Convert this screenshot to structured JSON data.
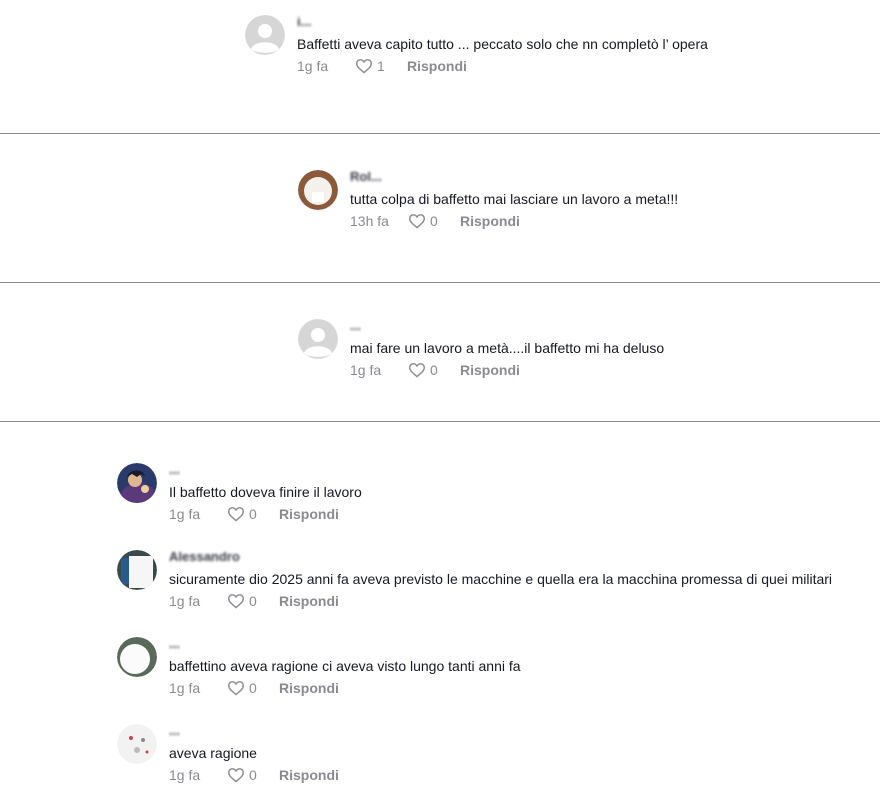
{
  "reply_label": "Rispondi",
  "colors": {
    "text": "#161823",
    "meta": "#8a8b91",
    "divider": "#8a8a8a",
    "default_avatar_bg": "#d6d6d6"
  },
  "comments": [
    {
      "user": "i...",
      "text": "Baffetti aveva capito tutto ... peccato solo che nn completò l’ opera",
      "time": "1g fa",
      "likes": "1",
      "avatar": "default-avatar"
    },
    {
      "user": "Rol...",
      "text": "tutta colpa di baffetto mai lasciare un lavoro a meta!!!",
      "time": "13h fa",
      "likes": "0",
      "avatar": "photo-avatar"
    },
    {
      "user": "...",
      "text": "mai fare un lavoro a metà....il baffetto mi ha deluso",
      "time": "1g fa",
      "likes": "0",
      "avatar": "default-avatar"
    },
    {
      "user": "...",
      "text": "Il baffetto doveva finire il lavoro",
      "time": "1g fa",
      "likes": "0",
      "avatar": "cartoon-avatar"
    },
    {
      "user": "Alessandro",
      "text": "sicuramente dio 2025 anni fa aveva previsto le macchine e quella era la macchina promessa di quei militari",
      "time": "1g fa",
      "likes": "0",
      "avatar": "photo-avatar"
    },
    {
      "user": "...",
      "text": "baffettino aveva ragione ci aveva visto lungo tanti anni fa",
      "time": "1g fa",
      "likes": "0",
      "avatar": "photo-avatar"
    },
    {
      "user": "...",
      "text": "aveva ragione",
      "time": "1g fa",
      "likes": "0",
      "avatar": "sticker-avatar"
    }
  ]
}
